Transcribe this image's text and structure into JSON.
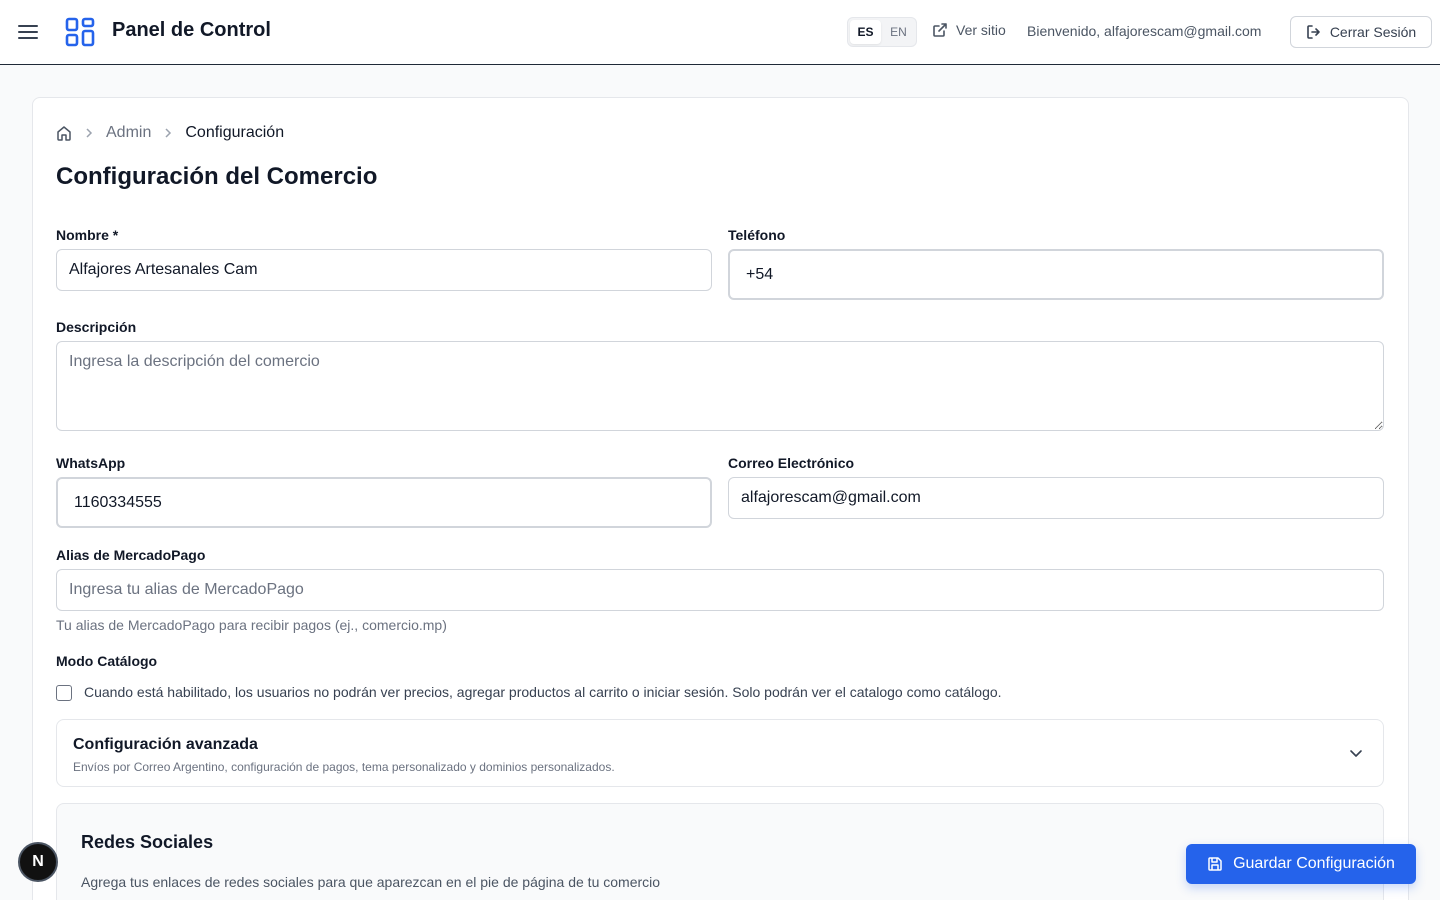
{
  "header": {
    "title": "Panel de Control",
    "languages": [
      "ES",
      "EN"
    ],
    "active_language": "ES",
    "view_site": "Ver sitio",
    "welcome": "Bienvenido, alfajorescam@gmail.com",
    "logout": "Cerrar Sesión"
  },
  "breadcrumb": {
    "items": [
      "Admin",
      "Configuración"
    ]
  },
  "page": {
    "title": "Configuración del Comercio"
  },
  "form": {
    "name": {
      "label": "Nombre *",
      "value": "Alfajores Artesanales Cam"
    },
    "phone": {
      "label": "Teléfono",
      "value": "+54"
    },
    "description": {
      "label": "Descripción",
      "placeholder": "Ingresa la descripción del comercio",
      "value": ""
    },
    "whatsapp": {
      "label": "WhatsApp",
      "value": "1160334555"
    },
    "email": {
      "label": "Correo Electrónico",
      "value": "alfajorescam@gmail.com"
    },
    "mp_alias": {
      "label": "Alias de MercadoPago",
      "placeholder": "Ingresa tu alias de MercadoPago",
      "help": "Tu alias de MercadoPago para recibir pagos (ej., comercio.mp)"
    },
    "catalog_mode": {
      "label": "Modo Catálogo",
      "text": "Cuando está habilitado, los usuarios no podrán ver precios, agregar productos al carrito o iniciar sesión. Solo podrán ver el catalogo como catálogo.",
      "checked": false
    }
  },
  "advanced": {
    "title": "Configuración avanzada",
    "subtitle": "Envíos por Correo Argentino, configuración de pagos, tema personalizado y dominios personalizados."
  },
  "social": {
    "title": "Redes Sociales",
    "subtitle": "Agrega tus enlaces de redes sociales para que aparezcan en el pie de página de tu comercio"
  },
  "actions": {
    "save": "Guardar Configuración"
  },
  "badge": {
    "letter": "N"
  },
  "colors": {
    "primary": "#2563eb",
    "text": "#111827",
    "muted": "#6b7280",
    "border": "#d1d5db"
  }
}
